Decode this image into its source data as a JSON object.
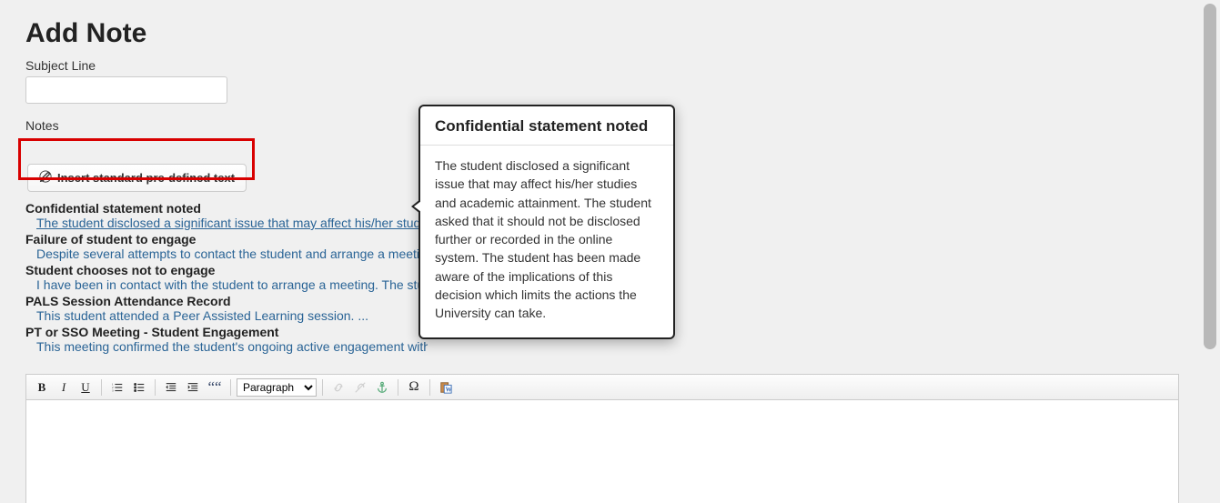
{
  "page": {
    "title": "Add Note",
    "subject_label": "Subject Line",
    "subject_value": "",
    "notes_label": "Notes"
  },
  "insert_button": {
    "label": "Insert standard pre-defined text"
  },
  "templates": [
    {
      "title": "Confidential statement noted",
      "preview": "The student disclosed a significant issue that may affect his/her stud ...",
      "underlined": true
    },
    {
      "title": "Failure of student to engage",
      "preview": "Despite several attempts to contact the student and arrange a meeting, ...",
      "underlined": false
    },
    {
      "title": "Student chooses not to engage",
      "preview": "I have been in contact with the student to arrange a meeting. The stud ...",
      "underlined": false
    },
    {
      "title": "PALS Session Attendance Record",
      "preview": "This student attended a Peer Assisted Learning session. ...",
      "underlined": false
    },
    {
      "title": "PT or SSO Meeting - Student Engagement",
      "preview": "This meeting confirmed the student's ongoing active engagement with th ...",
      "underlined": false
    }
  ],
  "tooltip": {
    "title": "Confidential statement noted",
    "body": "The student disclosed a significant issue that may affect his/her studies and academic attainment. The student asked that it should not be disclosed further or recorded in the online system. The student has been made aware of the implications of this decision which limits the actions the University can take."
  },
  "editor": {
    "format_selected": "Paragraph",
    "body_value": ""
  }
}
